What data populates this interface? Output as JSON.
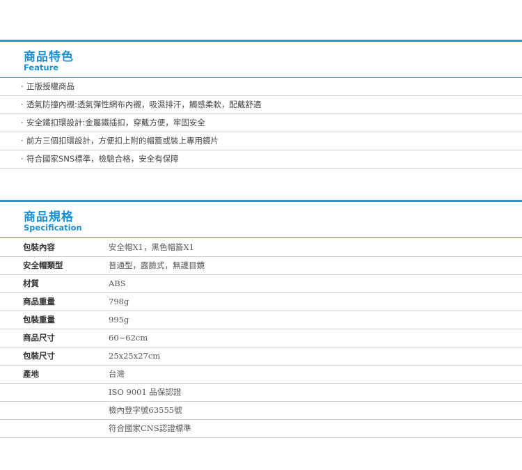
{
  "feature": {
    "title_zh": "商品特色",
    "title_en": "Feature",
    "bullet": "·",
    "items": [
      "正版授權商品",
      "透氣防撞內襯:透氣彈性網布內襯，吸濕排汗，觸感柔軟，配戴舒適",
      "安全鐵扣環設計:金屬鐵插扣，穿戴方便，牢固安全",
      "前方三個扣環設計，方便扣上附的帽簷或裝上專用鏡片",
      "符合國家SNS標準，檢驗合格，安全有保障"
    ]
  },
  "spec": {
    "title_zh": "商品規格",
    "title_en": "Specification",
    "rows": [
      {
        "label": "包裝內容",
        "value": "安全帽X1，黑色帽簷X1"
      },
      {
        "label": "安全帽類型",
        "value": "普通型，露臉式，無護目鏡"
      },
      {
        "label": "材質",
        "value": "ABS"
      },
      {
        "label": "商品重量",
        "value": "798g"
      },
      {
        "label": "包裝重量",
        "value": "995g"
      },
      {
        "label": "商品尺寸",
        "value": "60~62cm"
      },
      {
        "label": "包裝尺寸",
        "value": "25x25x27cm"
      },
      {
        "label": "產地",
        "value": "台灣"
      },
      {
        "label": "",
        "value": "ISO 9001 品保認證"
      },
      {
        "label": "",
        "value": "檢內登字號63555號"
      },
      {
        "label": "",
        "value": "符合國家CNS認證標準"
      }
    ]
  }
}
